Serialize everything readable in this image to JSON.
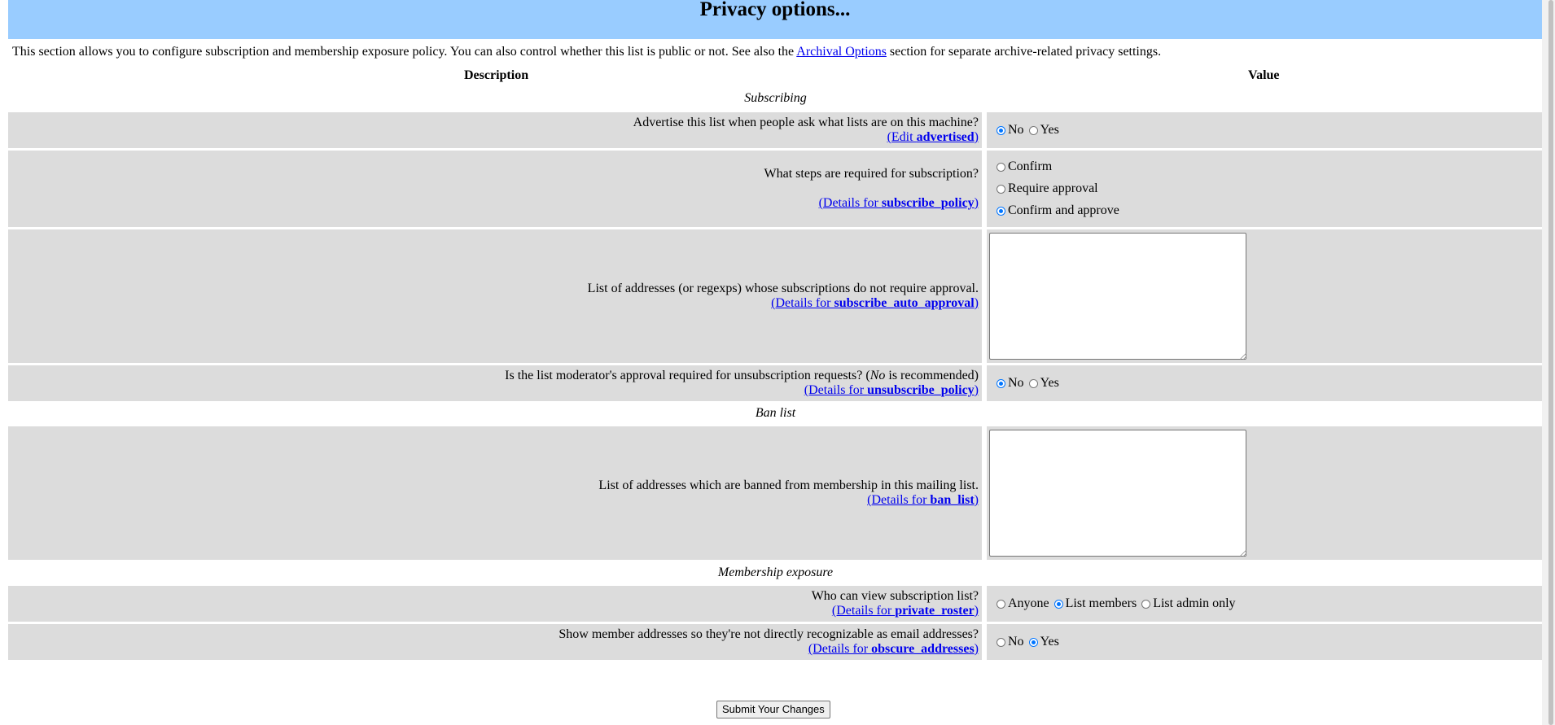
{
  "title": "Privacy options...",
  "intro": {
    "before": "This section allows you to configure subscription and membership exposure policy. You can also control whether this list is public or not. See also the ",
    "link": "Archival Options",
    "after": " section for separate archive-related privacy settings."
  },
  "headers": {
    "description": "Description",
    "value": "Value"
  },
  "sections": {
    "subscribing": "Subscribing",
    "ban_list": "Ban list",
    "membership": "Membership exposure"
  },
  "rows": {
    "advertised": {
      "question": "Advertise this list when people ask what lists are on this machine?",
      "link_prefix": "(Edit ",
      "link_name": "advertised",
      "link_suffix": ")",
      "options": [
        "No",
        "Yes"
      ],
      "selected": "No"
    },
    "subscribe_policy": {
      "question": "What steps are required for subscription?",
      "link_prefix": "(Details for ",
      "link_name": "subscribe_policy",
      "link_suffix": ")",
      "options": [
        "Confirm",
        "Require approval",
        "Confirm and approve"
      ],
      "selected": "Confirm and approve"
    },
    "subscribe_auto_approval": {
      "question": "List of addresses (or regexps) whose subscriptions do not require approval.",
      "link_prefix": "(Details for ",
      "link_name": "subscribe_auto_approval",
      "link_suffix": ")",
      "value": ""
    },
    "unsubscribe_policy": {
      "question_before": "Is the list moderator's approval required for unsubscription requests? (",
      "question_em": "No",
      "question_after": " is recommended)",
      "link_prefix": "(Details for ",
      "link_name": "unsubscribe_policy",
      "link_suffix": ")",
      "options": [
        "No",
        "Yes"
      ],
      "selected": "No"
    },
    "ban_list": {
      "question": "List of addresses which are banned from membership in this mailing list.",
      "link_prefix": "(Details for ",
      "link_name": "ban_list",
      "link_suffix": ")",
      "value": ""
    },
    "private_roster": {
      "question": "Who can view subscription list?",
      "link_prefix": "(Details for ",
      "link_name": "private_roster",
      "link_suffix": ")",
      "options": [
        "Anyone",
        "List members",
        "List admin only"
      ],
      "selected": "List members"
    },
    "obscure_addresses": {
      "question": "Show member addresses so they're not directly recognizable as email addresses?",
      "link_prefix": "(Details for ",
      "link_name": "obscure_addresses",
      "link_suffix": ")",
      "options": [
        "No",
        "Yes"
      ],
      "selected": "Yes"
    }
  },
  "submit_label": "Submit Your Changes",
  "colors": {
    "title_bg": "#99ccff",
    "row_bg": "#dcdcdc",
    "link": "#0000ee",
    "radio_accent": "#0075ff"
  }
}
